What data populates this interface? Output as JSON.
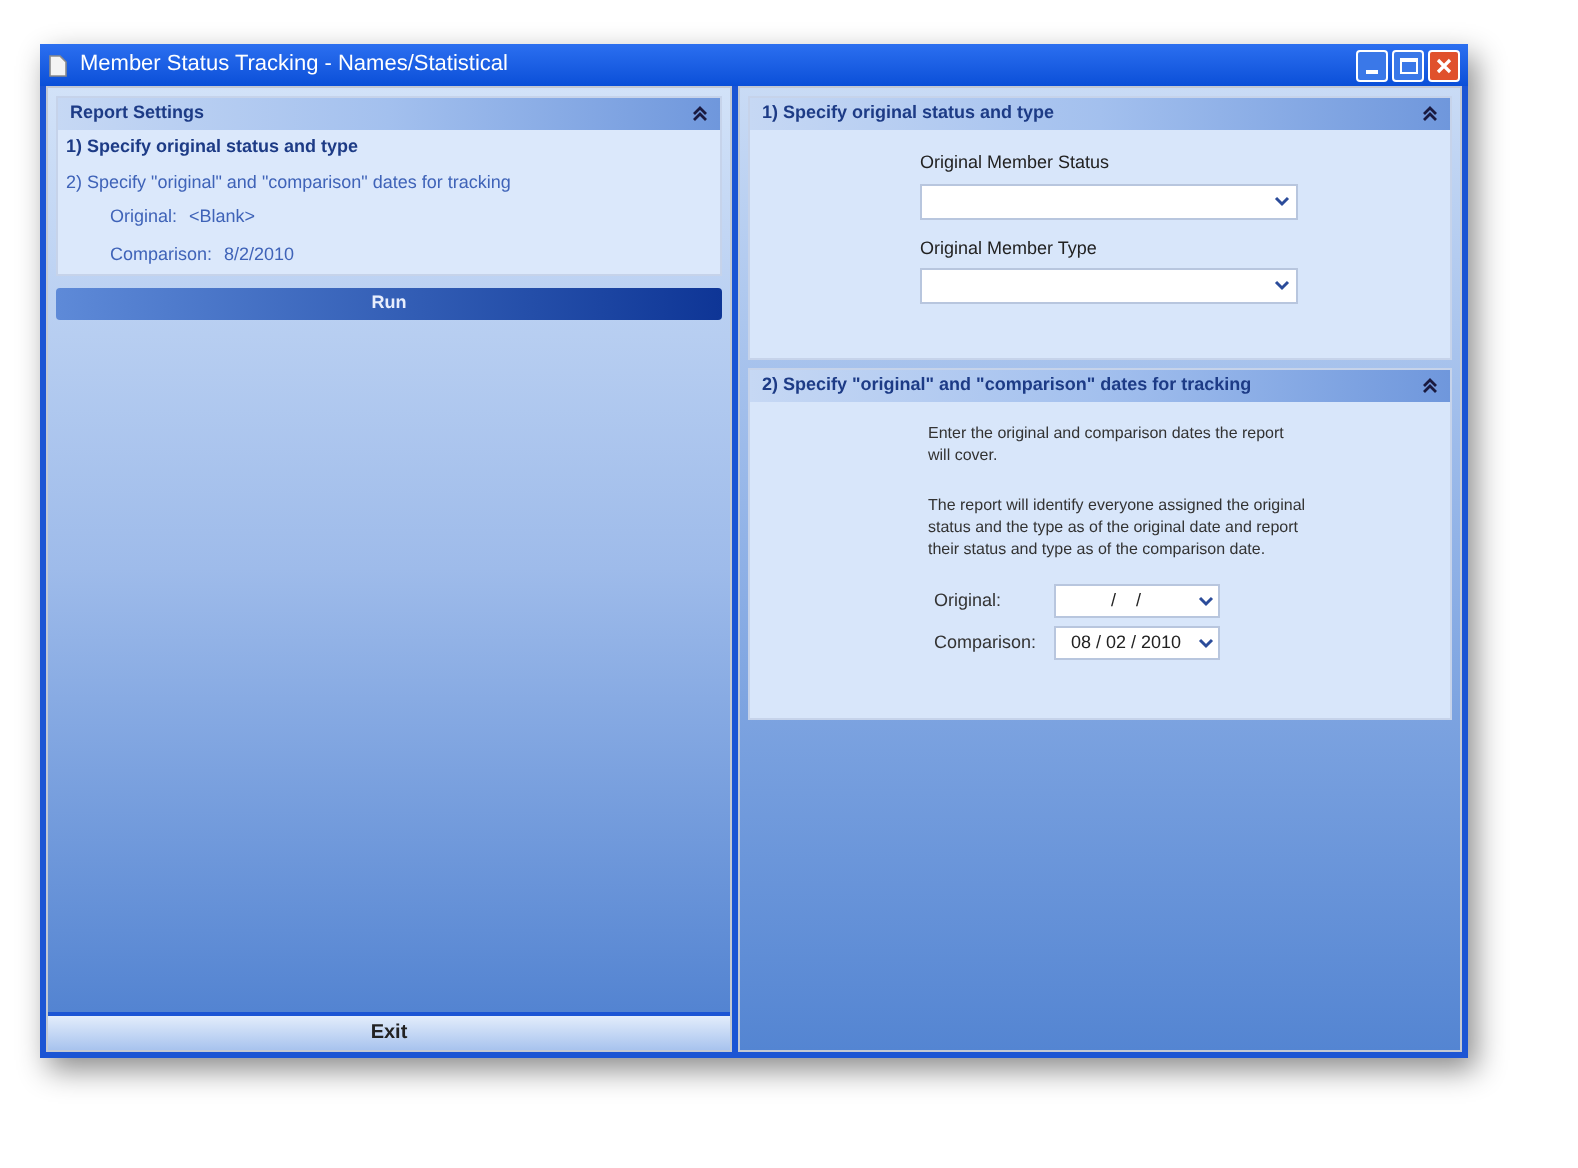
{
  "window": {
    "title": "Member Status Tracking - Names/Statistical"
  },
  "report_settings": {
    "title": "Report Settings",
    "steps": [
      {
        "label": "1)  Specify original status and type",
        "selected": true
      },
      {
        "label": "2) Specify \"original\" and \"comparison\" dates for tracking",
        "selected": false
      }
    ],
    "details": [
      {
        "label": "Original:",
        "value": "<Blank>"
      },
      {
        "label": "Comparison:",
        "value": "8/2/2010"
      }
    ]
  },
  "run_button": "Run",
  "exit_button": "Exit",
  "section_1": {
    "title": "1)  Specify original status and type",
    "fields": [
      {
        "label": "Original Member Status"
      },
      {
        "label": "Original Member Type"
      }
    ]
  },
  "section_2": {
    "title": "2)  Specify \"original\" and \"comparison\" dates for tracking",
    "paragraphs": [
      "Enter the original and comparison dates the report will cover.",
      "The report will identify everyone assigned the original status and the type as of the original date and report their status and type as of the comparison date."
    ],
    "dates": [
      {
        "label": "Original:",
        "value": "/    /"
      },
      {
        "label": "Comparison:",
        "value": "08 / 02 / 2010"
      }
    ]
  }
}
